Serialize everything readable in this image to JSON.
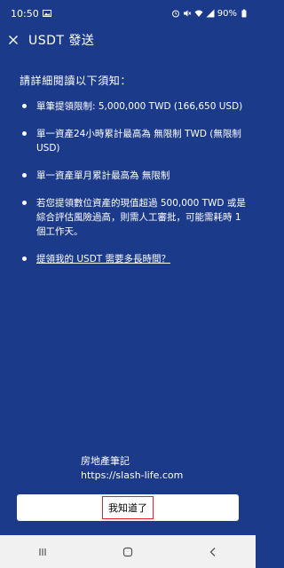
{
  "status_bar": {
    "time": "10:50",
    "battery": "90%"
  },
  "header": {
    "title": "USDT 發送"
  },
  "notice": {
    "heading": "請詳細閱讀以下須知：",
    "items": [
      "單筆提領限制: 5,000,000 TWD (166,650 USD)",
      "單一資產24小時累計最高為 無限制 TWD (無限制 USD)",
      "單一資產單月累計最高為 無限制",
      "若您提領數位資產的現值超過 500,000 TWD 或是綜合評估風險過高，則需人工審批，可能需耗時 1 個工作天。",
      "提領我的 USDT 需要多長時間？"
    ]
  },
  "watermark": {
    "line1": "房地產筆記",
    "line2": "https://slash-life.com"
  },
  "footer": {
    "ack_label": "我知道了"
  },
  "colors": {
    "background": "#1b3a8a",
    "button": "#ffffff",
    "highlight_border": "#e0242a"
  }
}
